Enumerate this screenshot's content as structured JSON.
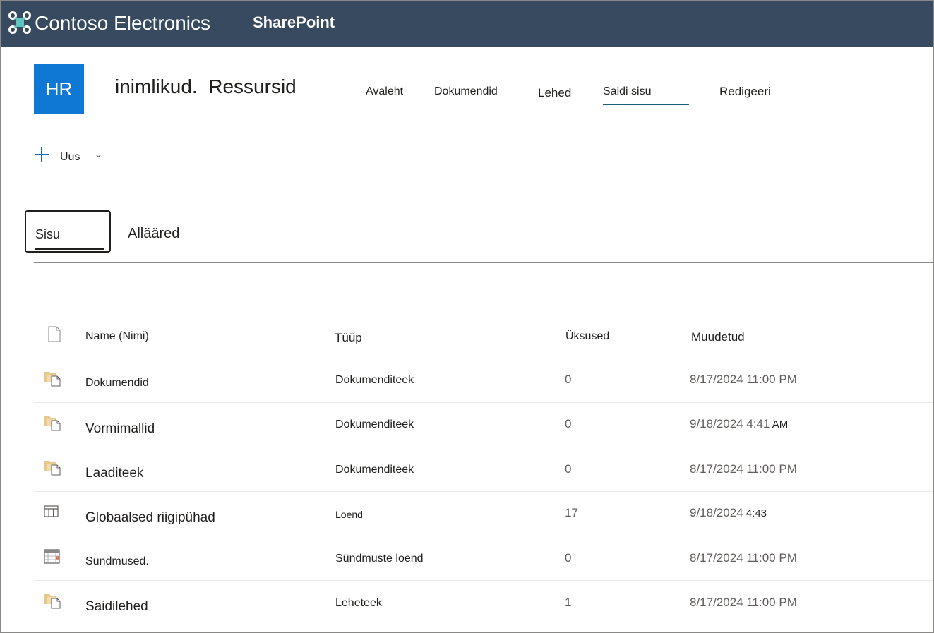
{
  "suitebar": {
    "org_name": "Contoso Electronics",
    "app_name": "SharePoint",
    "bg_color": "#374a5f",
    "logo_icon": "contoso-logo-icon"
  },
  "site": {
    "logo_text": "HR",
    "logo_color": "#0f78d4",
    "title": "inimlikud.  Ressursid",
    "nav": [
      {
        "label": "Avaleht",
        "selected": false
      },
      {
        "label": "Dokumendid",
        "selected": false
      },
      {
        "label": "Lehed",
        "selected": false
      },
      {
        "label": "Saidi sisu",
        "selected": true
      },
      {
        "label": "Redigeeri",
        "selected": false
      }
    ]
  },
  "command_bar": {
    "new_label": "Uus",
    "new_icon": "plus-icon",
    "chevron_icon": "chevron-down-icon"
  },
  "pivot": {
    "tabs": [
      {
        "label": "Sisu",
        "selected": true
      },
      {
        "label": "Allääred",
        "selected": false
      }
    ]
  },
  "table": {
    "headers": {
      "name": "Name (Nimi)",
      "type": "Tüüp",
      "items": "Üksused",
      "modified": "Muudetud"
    },
    "rows": [
      {
        "icon": "document-library-icon",
        "name": "Dokumendid",
        "type": "Dokumenditeek",
        "items": "0",
        "modified": "8/17/2024 11:00 PM",
        "modified_suffix": ""
      },
      {
        "icon": "document-library-icon",
        "name": "Vormimallid",
        "type": "Dokumenditeek",
        "items": "0",
        "modified": "9/18/2024 4:41",
        "modified_suffix": " AM"
      },
      {
        "icon": "document-library-icon",
        "name": "Laaditeek",
        "type": "Dokumenditeek",
        "items": "0",
        "modified": "8/17/2024 11:00 PM",
        "modified_suffix": ""
      },
      {
        "icon": "list-icon",
        "name": "Globaalsed riigipühad",
        "type": "Loend",
        "items": "17",
        "modified": "9/18/2024",
        "modified_suffix": " 4:43"
      },
      {
        "icon": "calendar-icon",
        "name": "Sündmused.",
        "type": "Sündmuste loend",
        "items": "0",
        "modified": "8/17/2024 11:00 PM",
        "modified_suffix": ""
      },
      {
        "icon": "document-library-icon",
        "name": "Saidilehed",
        "type": "Leheteek",
        "items": "1",
        "modified": "8/17/2024 11:00 PM",
        "modified_suffix": ""
      }
    ]
  }
}
